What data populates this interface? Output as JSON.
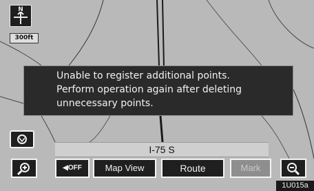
{
  "compass": {
    "letter": "N",
    "icon": "north-up-arrow-icon"
  },
  "scale": {
    "label": "300ft"
  },
  "message": {
    "lines": [
      "Unable to register additional points.",
      "Perform operation again after deleting",
      "unnecessary points."
    ]
  },
  "buttons": {
    "current_location_icon": "current-location-icon",
    "zoom_in_icon": "zoom-in-icon",
    "voice_off_label": "OFF",
    "voice_icon": "speaker-icon",
    "map_view_label": "Map View",
    "route_label": "Route",
    "mark_label": "Mark",
    "zoom_out_icon": "zoom-out-icon"
  },
  "road": {
    "name": "I-75 S"
  },
  "figure_code": "1U015a",
  "colors": {
    "map_background": "#b9b9b9",
    "button_fill": "#1f1f1f",
    "button_border": "#f4f4f4",
    "message_fill": "#2a2a2a",
    "disabled_button_fill": "#8e8e8e"
  }
}
